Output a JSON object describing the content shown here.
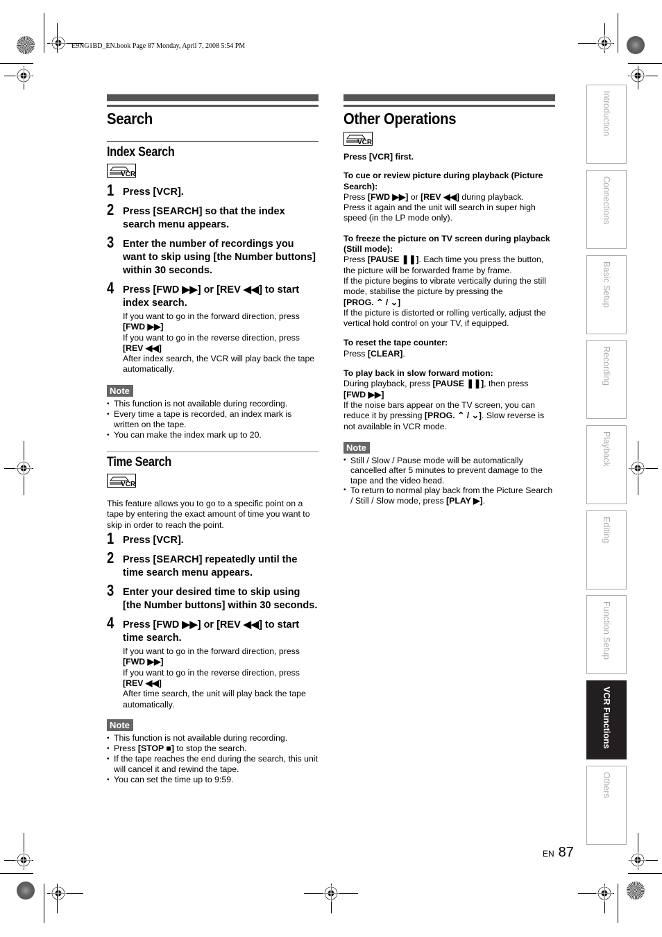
{
  "slug": "E9NG1BD_EN.book  Page 87  Monday, April 7, 2008  5:54 PM",
  "left": {
    "title": "Search",
    "index_search": {
      "heading": "Index Search",
      "badge": "VCR",
      "steps": [
        {
          "num": "1",
          "text": "Press [VCR]."
        },
        {
          "num": "2",
          "text": "Press [SEARCH] so that the index search menu appears."
        },
        {
          "num": "3",
          "text": "Enter the number of recordings you want to skip using [the Number buttons] within 30 seconds."
        },
        {
          "num": "4",
          "text": "Press [FWD ▶▶] or [REV ◀◀] to start index search."
        }
      ],
      "details": [
        "If you want to go in the forward direction, press",
        "[FWD ▶▶]",
        "If you want to go in the reverse direction, press",
        "[REV ◀◀]",
        "After index search, the VCR will play back the tape automatically."
      ],
      "note_label": "Note",
      "notes": [
        "This function is not available during recording.",
        "Every time a tape is recorded, an index mark is written on the tape.",
        "You can make the index mark up to 20."
      ]
    },
    "time_search": {
      "heading": "Time Search",
      "badge": "VCR",
      "intro": "This feature allows you to go to a specific point on a tape by entering the exact amount of time you want to skip in order to reach the point.",
      "steps": [
        {
          "num": "1",
          "text": "Press [VCR]."
        },
        {
          "num": "2",
          "text": "Press [SEARCH] repeatedly until the time search menu appears."
        },
        {
          "num": "3",
          "text": "Enter your desired time to skip using [the Number buttons] within 30 seconds."
        },
        {
          "num": "4",
          "text": "Press [FWD ▶▶] or [REV ◀◀] to start time search."
        }
      ],
      "details": [
        "If you want to go in the forward direction, press",
        "[FWD ▶▶]",
        "If you want to go in the reverse direction, press",
        "[REV ◀◀]",
        "After time search, the unit will play back the tape automatically."
      ],
      "note_label": "Note",
      "notes": [
        "This function is not available during recording.",
        "Press ",
        "[STOP ■]",
        " to stop the search.",
        "If the tape reaches the end during the search, this unit will cancel it and rewind the tape.",
        "You can set the time up to 9:59."
      ]
    }
  },
  "right": {
    "title": "Other Operations",
    "badge": "VCR",
    "first": "Press [VCR] first.",
    "sections": [
      {
        "heading": "To cue or review picture during playback (Picture Search):",
        "parts": [
          "Press ",
          "[FWD ▶▶]",
          " or ",
          "[REV ◀◀]",
          " during playback.",
          "Press it again and the unit will search in super high speed (in the LP mode only)."
        ]
      },
      {
        "heading": "To freeze the picture on TV screen during playback (Still mode):",
        "parts": [
          "Press ",
          "[PAUSE ❚❚]",
          ". Each time you press the button, the picture will be forwarded frame by frame.",
          "If the picture begins to vibrate vertically during the still mode, stabilise the picture by pressing the",
          "[PROG. ⌃ / ⌄]",
          "If the picture is distorted or rolling vertically, adjust the vertical hold control on your TV, if equipped."
        ]
      },
      {
        "heading": "To reset the tape counter:",
        "parts": [
          "Press ",
          "[CLEAR]",
          "."
        ]
      },
      {
        "heading": "To play back in slow forward motion:",
        "parts": [
          "During playback, press ",
          "[PAUSE ❚❚]",
          ", then press",
          "[FWD ▶▶]",
          "If the noise bars appear on the TV screen, you can reduce it by pressing ",
          "[PROG. ⌃ / ⌄]",
          ". Slow reverse is not available in VCR mode."
        ]
      }
    ],
    "note_label": "Note",
    "notes": [
      "Still / Slow / Pause mode will be automatically cancelled after 5 minutes to prevent damage to the tape and the video head.",
      "To return to normal play back from the Picture Search / Still / Slow mode, press ",
      "[PLAY ▶]"
    ]
  },
  "tabs": [
    {
      "label": "Introduction",
      "active": false
    },
    {
      "label": "Connections",
      "active": false
    },
    {
      "label": "Basic Setup",
      "active": false
    },
    {
      "label": "Recording",
      "active": false
    },
    {
      "label": "Playback",
      "active": false
    },
    {
      "label": "Editing",
      "active": false
    },
    {
      "label": "Function Setup",
      "active": false
    },
    {
      "label": "VCR Functions",
      "active": true
    },
    {
      "label": "Others",
      "active": false
    }
  ],
  "footer": {
    "lang": "EN",
    "page": "87"
  }
}
